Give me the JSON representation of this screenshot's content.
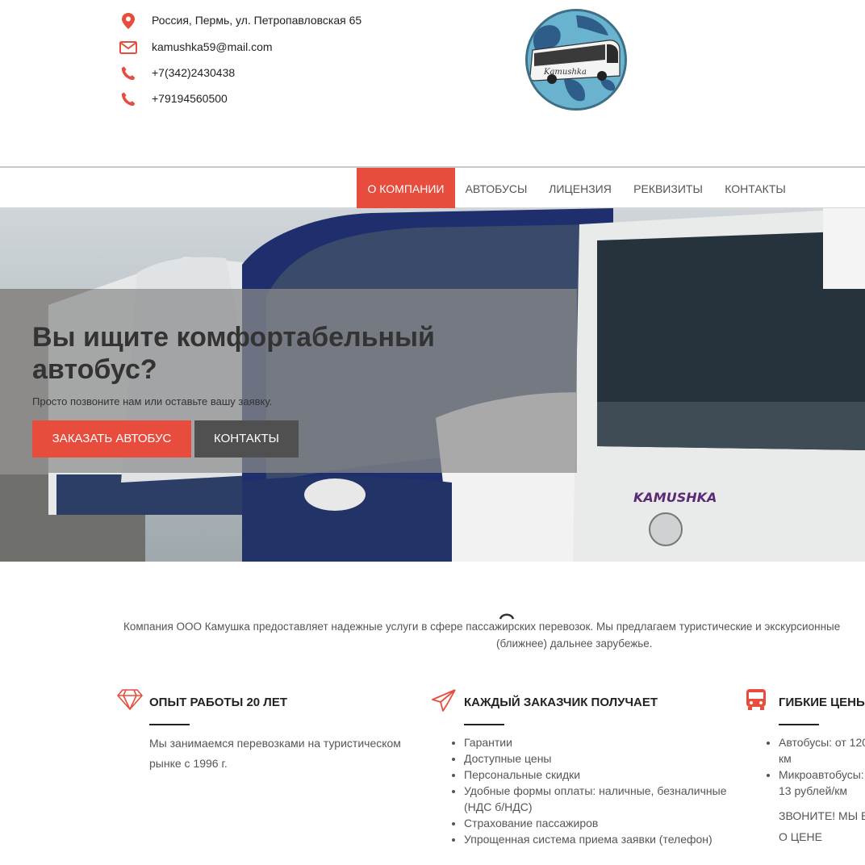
{
  "contacts": {
    "address": "Россия, Пермь, ул. Петропавловская 65",
    "email": "kamushka59@mail.com",
    "phone1": "+7(342)2430438",
    "phone2": "+79194560500"
  },
  "logo": {
    "text": "Kamushka"
  },
  "nav": {
    "items": [
      "О КОМПАНИИ",
      "АВТОБУСЫ",
      "ЛИЦЕНЗИЯ",
      "РЕКВИЗИТЫ",
      "КОНТАКТЫ"
    ],
    "active": "О КОМПАНИИ"
  },
  "hero": {
    "title": "Вы ищите комфортабельный автобус?",
    "subtitle": "Просто позвоните нам или оставьте вашу заявку.",
    "order_button": "ЗАКАЗАТЬ АВТОБУС",
    "contacts_button": "КОНТАКТЫ",
    "bus_brand": "KAMUSHKA"
  },
  "about": {
    "line1": "Компания ООО Камушка предоставляет надежные услуги в сфере пассажирских перевозок. Мы предлагаем туристические и экскурсионные",
    "line2": "(ближнее) дальнее зарубежье."
  },
  "features": {
    "experience": {
      "title": "ОПЫТ РАБОТЫ 20 ЛЕТ",
      "text": "Мы занимаемся перевозками на туристическом рынке с 1996 г."
    },
    "customer": {
      "title": "КАЖДЫЙ ЗАКАЗЧИК ПОЛУЧАЕТ",
      "items": [
        "Гарантии",
        "Доступные цены",
        "Персональные скидки",
        "Удобные формы оплаты: наличные, безналичные (НДС б/НДС)",
        "Страхование пассажиров",
        "Упрощенная система приема заявки (телефон)"
      ]
    },
    "prices": {
      "title": "ГИБКИЕ ЦЕНЬ",
      "items": [
        "Автобусы: от 120 км",
        "Микроавтобусы: 13 рублей/км"
      ],
      "note1": "ЗВОНИТЕ! МЫ В",
      "note2": "О ЦЕНЕ"
    }
  },
  "colors": {
    "accent": "#e74c3c",
    "dark_button": "#505050"
  }
}
